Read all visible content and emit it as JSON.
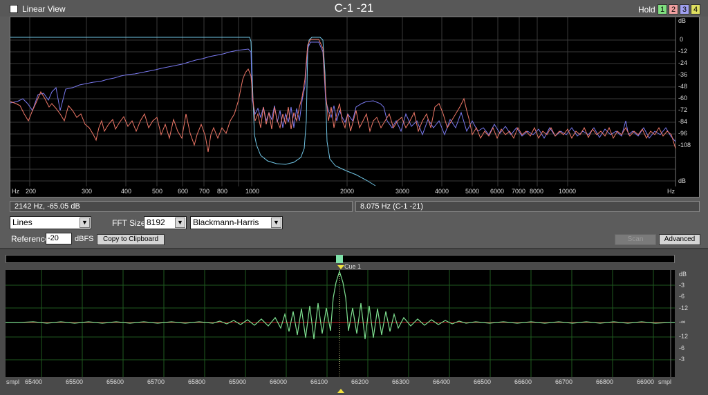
{
  "topbar": {
    "linear_view_label": "Linear View",
    "title": "C-1 -21",
    "hold_label": "Hold",
    "hold_buttons": [
      "1",
      "2",
      "3",
      "4"
    ]
  },
  "colors": {
    "blue": "#7a7af0",
    "red": "#f07868",
    "cyan": "#72c8e8",
    "green": "#60e060",
    "hold1": "#80e080",
    "hold2": "#f0a0a0",
    "hold3": "#a0a0f0",
    "hold4": "#e0e060"
  },
  "spectrum": {
    "y_unit": "dB",
    "y_ticks": [
      "0",
      "-12",
      "-24",
      "-36",
      "-48",
      "-60",
      "-72",
      "-84",
      "-96",
      "-108"
    ],
    "x_unit_left": "Hz",
    "x_unit_right": "Hz",
    "x_ticks": [
      "200",
      "300",
      "400",
      "500",
      "600",
      "700",
      "800",
      "1000",
      "2000",
      "3000",
      "4000",
      "5000",
      "6000",
      "7000",
      "8000",
      "10000"
    ]
  },
  "status": {
    "cursor_readout": "2142 Hz, -65.05 dB",
    "peak_readout": "8.075 Hz (C-1 -21)"
  },
  "controls": {
    "display_mode": "Lines",
    "fft_size_label": "FFT Size",
    "fft_size": "8192",
    "window": "Blackmann-Harris",
    "reference_label": "Reference",
    "reference_value": "-20",
    "reference_unit": "dBFS",
    "copy_button": "Copy to Clipboard",
    "scan_button": "Scan",
    "advanced_button": "Advanced"
  },
  "waveform": {
    "cue_label": "Cue 1",
    "y_ticks_top": [
      "dB",
      "-3",
      "-6",
      "-12"
    ],
    "y_center": "-∞",
    "y_ticks_bottom": [
      "-12",
      "-6",
      "-3"
    ],
    "x_unit": "smpl",
    "x_ticks": [
      "65400",
      "65500",
      "65600",
      "65700",
      "65800",
      "65900",
      "66000",
      "66100",
      "66200",
      "66300",
      "66400",
      "66500",
      "66600",
      "66700",
      "66800",
      "66900"
    ]
  }
}
